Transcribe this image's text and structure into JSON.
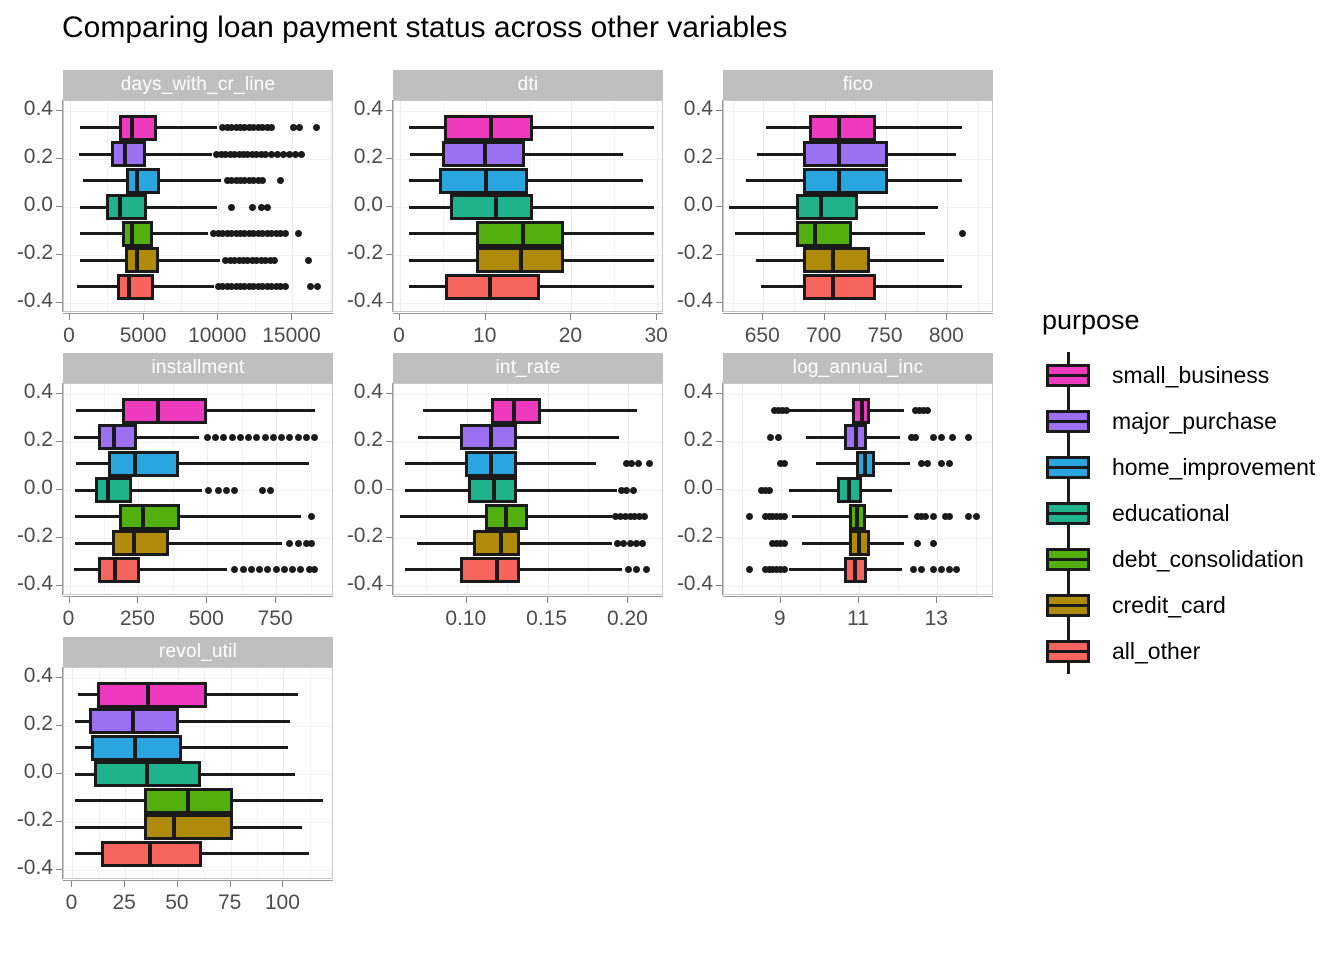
{
  "title": "Comparing loan payment status across other variables",
  "legend": {
    "title": "purpose",
    "items": [
      {
        "label": "small_business",
        "color": "#ED3ABF"
      },
      {
        "label": "major_purchase",
        "color": "#9B71F2"
      },
      {
        "label": "home_improvement",
        "color": "#2AA5E0"
      },
      {
        "label": "educational",
        "color": "#20B28A"
      },
      {
        "label": "debt_consolidation",
        "color": "#53AF0E"
      },
      {
        "label": "credit_card",
        "color": "#B08A0B"
      },
      {
        "label": "all_other",
        "color": "#F5655E"
      }
    ]
  },
  "facets": [
    {
      "name": "days_with_cr_line"
    },
    {
      "name": "dti"
    },
    {
      "name": "fico"
    },
    {
      "name": "installment"
    },
    {
      "name": "int_rate"
    },
    {
      "name": "log_annual_inc"
    },
    {
      "name": "revol_util"
    }
  ],
  "y_axis": {
    "ticks": [
      "0.4",
      "0.2",
      "0.0",
      "-0.2",
      "-0.4"
    ],
    "values": [
      0.4,
      0.2,
      0.0,
      -0.2,
      -0.4
    ],
    "limits": [
      -0.44,
      0.44
    ]
  },
  "chart_data": {
    "type": "box",
    "title": "Comparing loan payment status across other variables",
    "orientation": "horizontal",
    "legend_title": "purpose",
    "legend_position": "right",
    "grid": true,
    "ylabel": "",
    "xlabel": "",
    "y_tick_labels": [
      "0.4",
      "0.2",
      "0.0",
      "-0.2",
      "-0.4"
    ],
    "y_positions_by_group": [
      0.33,
      0.22,
      0.11,
      0.0,
      -0.11,
      -0.22,
      -0.33
    ],
    "groups": [
      "small_business",
      "major_purchase",
      "home_improvement",
      "educational",
      "debt_consolidation",
      "credit_card",
      "all_other"
    ],
    "group_colors": [
      "#ED3ABF",
      "#9B71F2",
      "#2AA5E0",
      "#20B28A",
      "#53AF0E",
      "#B08A0B",
      "#F5655E"
    ],
    "panels": [
      {
        "name": "days_with_cr_line",
        "xlim": [
          -400,
          17800
        ],
        "xticks": [
          0,
          5000,
          10000,
          15000
        ],
        "xtick_labels": [
          "0",
          "5000",
          "10000",
          "15000"
        ],
        "boxes": [
          {
            "group": "small_business",
            "lo": 680,
            "q1": 3300,
            "med": 4200,
            "q3": 5900,
            "hi": 9900,
            "outliers": [
              10300,
              10600,
              10900,
              11200,
              11500,
              11800,
              12100,
              12400,
              12700,
              13000,
              13300,
              13600,
              15100,
              15500,
              16600
            ]
          },
          {
            "group": "major_purchase",
            "lo": 600,
            "q1": 2800,
            "med": 3700,
            "q3": 5100,
            "hi": 9600,
            "outliers": [
              9900,
              10200,
              10500,
              10800,
              11100,
              11400,
              11700,
              12000,
              12300,
              12600,
              12900,
              13200,
              13600,
              14000,
              14400,
              14800,
              15200,
              15600
            ]
          },
          {
            "group": "home_improvement",
            "lo": 900,
            "q1": 3800,
            "med": 4500,
            "q3": 6100,
            "hi": 10200,
            "outliers": [
              10600,
              10900,
              11200,
              11500,
              11800,
              12100,
              12400,
              12700,
              13000,
              14200
            ]
          },
          {
            "group": "educational",
            "lo": 700,
            "q1": 2400,
            "med": 3400,
            "q3": 5200,
            "hi": 9900,
            "outliers": [
              10900,
              12300,
              12900,
              13300
            ]
          },
          {
            "group": "debt_consolidation",
            "lo": 700,
            "q1": 3500,
            "med": 4200,
            "q3": 5600,
            "hi": 9300,
            "outliers": [
              9700,
              10000,
              10300,
              10600,
              10900,
              11200,
              11500,
              11800,
              12100,
              12400,
              12700,
              13000,
              13300,
              13600,
              13900,
              14200,
              14500,
              15400
            ]
          },
          {
            "group": "credit_card",
            "lo": 700,
            "q1": 3700,
            "med": 4500,
            "q3": 6000,
            "hi": 10100,
            "outliers": [
              10500,
              10800,
              11100,
              11400,
              11700,
              12000,
              12300,
              12600,
              12900,
              13200,
              13500,
              13800,
              16100
            ]
          },
          {
            "group": "all_other",
            "lo": 500,
            "q1": 3200,
            "med": 4000,
            "q3": 5700,
            "hi": 9700,
            "outliers": [
              10000,
              10300,
              10600,
              10900,
              11200,
              11500,
              11800,
              12100,
              12400,
              12700,
              13000,
              13300,
              13600,
              13900,
              14200,
              14500,
              16200,
              16700
            ]
          }
        ]
      },
      {
        "name": "dti",
        "xlim": [
          -0.7,
          30.8
        ],
        "xticks": [
          0,
          10,
          20,
          30
        ],
        "xtick_labels": [
          "0",
          "10",
          "20",
          "30"
        ],
        "boxes": [
          {
            "group": "small_business",
            "lo": 1.1,
            "q1": 5.1,
            "med": 10.6,
            "q3": 15.5,
            "hi": 29.6,
            "outliers": []
          },
          {
            "group": "major_purchase",
            "lo": 1.2,
            "q1": 4.9,
            "med": 9.9,
            "q3": 14.6,
            "hi": 26.0,
            "outliers": []
          },
          {
            "group": "home_improvement",
            "lo": 1.0,
            "q1": 4.6,
            "med": 10.0,
            "q3": 14.9,
            "hi": 28.3,
            "outliers": []
          },
          {
            "group": "educational",
            "lo": 1.1,
            "q1": 5.8,
            "med": 11.2,
            "q3": 15.5,
            "hi": 29.6,
            "outliers": []
          },
          {
            "group": "debt_consolidation",
            "lo": 1.0,
            "q1": 8.9,
            "med": 14.3,
            "q3": 19.1,
            "hi": 29.6,
            "outliers": []
          },
          {
            "group": "credit_card",
            "lo": 1.0,
            "q1": 8.9,
            "med": 14.1,
            "q3": 19.1,
            "hi": 29.6,
            "outliers": []
          },
          {
            "group": "all_other",
            "lo": 1.0,
            "q1": 5.3,
            "med": 10.5,
            "q3": 16.3,
            "hi": 29.6,
            "outliers": []
          }
        ]
      },
      {
        "name": "fico",
        "xlim": [
          618,
          838
        ],
        "xticks": [
          650,
          700,
          750,
          800
        ],
        "xtick_labels": [
          "650",
          "700",
          "750",
          "800"
        ],
        "boxes": [
          {
            "group": "small_business",
            "lo": 652,
            "q1": 687,
            "med": 712,
            "q3": 742,
            "hi": 812,
            "outliers": []
          },
          {
            "group": "major_purchase",
            "lo": 645,
            "q1": 682,
            "med": 712,
            "q3": 752,
            "hi": 807,
            "outliers": []
          },
          {
            "group": "home_improvement",
            "lo": 636,
            "q1": 682,
            "med": 712,
            "q3": 752,
            "hi": 812,
            "outliers": []
          },
          {
            "group": "educational",
            "lo": 622,
            "q1": 677,
            "med": 697,
            "q3": 727,
            "hi": 792,
            "outliers": []
          },
          {
            "group": "debt_consolidation",
            "lo": 627,
            "q1": 677,
            "med": 692,
            "q3": 722,
            "hi": 782,
            "outliers": [
              812
            ]
          },
          {
            "group": "credit_card",
            "lo": 644,
            "q1": 682,
            "med": 707,
            "q3": 737,
            "hi": 797,
            "outliers": []
          },
          {
            "group": "all_other",
            "lo": 648,
            "q1": 682,
            "med": 707,
            "q3": 742,
            "hi": 812,
            "outliers": []
          }
        ]
      },
      {
        "name": "installment",
        "xlim": [
          -20,
          960
        ],
        "xticks": [
          0,
          250,
          500,
          750
        ],
        "xtick_labels": [
          "0",
          "250",
          "500",
          "750"
        ],
        "boxes": [
          {
            "group": "small_business",
            "lo": 22,
            "q1": 192,
            "med": 320,
            "q3": 500,
            "hi": 890,
            "outliers": []
          },
          {
            "group": "major_purchase",
            "lo": 16,
            "q1": 105,
            "med": 160,
            "q3": 244,
            "hi": 470,
            "outliers": [
              500,
              530,
              560,
              590,
              620,
              650,
              680,
              710,
              740,
              770,
              800,
              830,
              860,
              890
            ]
          },
          {
            "group": "home_improvement",
            "lo": 24,
            "q1": 140,
            "med": 236,
            "q3": 398,
            "hi": 870,
            "outliers": []
          },
          {
            "group": "educational",
            "lo": 20,
            "q1": 92,
            "med": 140,
            "q3": 228,
            "hi": 480,
            "outliers": [
              505,
              540,
              570,
              600,
              700,
              730
            ]
          },
          {
            "group": "debt_consolidation",
            "lo": 20,
            "q1": 178,
            "med": 266,
            "q3": 400,
            "hi": 840,
            "outliers": [
              880
            ]
          },
          {
            "group": "credit_card",
            "lo": 20,
            "q1": 156,
            "med": 234,
            "q3": 360,
            "hi": 770,
            "outliers": [
              800,
              830,
              860,
              880
            ]
          },
          {
            "group": "all_other",
            "lo": 18,
            "q1": 105,
            "med": 166,
            "q3": 256,
            "hi": 570,
            "outliers": [
              600,
              630,
              660,
              690,
              720,
              750,
              780,
              810,
              840,
              870,
              890
            ]
          }
        ]
      },
      {
        "name": "int_rate",
        "xlim": [
          0.055,
          0.222
        ],
        "xticks": [
          0.1,
          0.15,
          0.2
        ],
        "xtick_labels": [
          "0.10",
          "0.15",
          "0.20"
        ],
        "boxes": [
          {
            "group": "small_business",
            "lo": 0.073,
            "q1": 0.115,
            "med": 0.129,
            "q3": 0.146,
            "hi": 0.205,
            "outliers": []
          },
          {
            "group": "major_purchase",
            "lo": 0.07,
            "q1": 0.096,
            "med": 0.115,
            "q3": 0.131,
            "hi": 0.194,
            "outliers": []
          },
          {
            "group": "home_improvement",
            "lo": 0.062,
            "q1": 0.099,
            "med": 0.115,
            "q3": 0.131,
            "hi": 0.18,
            "outliers": [
              0.199,
              0.202,
              0.206,
              0.213
            ]
          },
          {
            "group": "educational",
            "lo": 0.062,
            "q1": 0.101,
            "med": 0.117,
            "q3": 0.131,
            "hi": 0.193,
            "outliers": [
              0.196,
              0.199,
              0.203
            ]
          },
          {
            "group": "debt_consolidation",
            "lo": 0.059,
            "q1": 0.111,
            "med": 0.124,
            "q3": 0.138,
            "hi": 0.19,
            "outliers": [
              0.192,
              0.195,
              0.198,
              0.201,
              0.204,
              0.207,
              0.21
            ]
          },
          {
            "group": "credit_card",
            "lo": 0.069,
            "q1": 0.104,
            "med": 0.121,
            "q3": 0.133,
            "hi": 0.19,
            "outliers": [
              0.193,
              0.197,
              0.201,
              0.205,
              0.209
            ]
          },
          {
            "group": "all_other",
            "lo": 0.062,
            "q1": 0.096,
            "med": 0.119,
            "q3": 0.133,
            "hi": 0.196,
            "outliers": [
              0.2,
              0.205,
              0.211
            ]
          }
        ]
      },
      {
        "name": "log_annual_inc",
        "xlim": [
          7.55,
          14.45
        ],
        "xticks": [
          9,
          11,
          13
        ],
        "xtick_labels": [
          "9",
          "11",
          "13"
        ],
        "boxes": [
          {
            "group": "small_business",
            "lo": 9.21,
            "q1": 10.82,
            "med": 11.08,
            "q3": 11.29,
            "hi": 12.15,
            "outliers": [
              8.85,
              8.95,
              9.05,
              9.15,
              12.45,
              12.55,
              12.65,
              12.75
            ]
          },
          {
            "group": "major_purchase",
            "lo": 9.65,
            "q1": 10.62,
            "med": 10.93,
            "q3": 11.2,
            "hi": 12.05,
            "outliers": [
              8.75,
              8.95,
              12.35,
              12.45,
              12.9,
              13.1,
              13.4,
              13.8
            ]
          },
          {
            "group": "home_improvement",
            "lo": 9.9,
            "q1": 10.92,
            "med": 11.15,
            "q3": 11.4,
            "hi": 12.3,
            "outliers": [
              9.0,
              9.1,
              12.6,
              12.75,
              13.1,
              13.3
            ]
          },
          {
            "group": "educational",
            "lo": 9.2,
            "q1": 10.45,
            "med": 10.75,
            "q3": 11.07,
            "hi": 11.85,
            "outliers": [
              8.5,
              8.6,
              8.7
            ]
          },
          {
            "group": "debt_consolidation",
            "lo": 9.3,
            "q1": 10.75,
            "med": 10.95,
            "q3": 11.18,
            "hi": 12.25,
            "outliers": [
              8.2,
              8.6,
              8.7,
              8.8,
              8.9,
              9.0,
              9.1,
              12.5,
              12.6,
              12.7,
              12.9,
              13.2,
              13.3,
              13.8,
              14.0
            ]
          },
          {
            "group": "credit_card",
            "lo": 9.55,
            "q1": 10.75,
            "med": 11.0,
            "q3": 11.28,
            "hi": 12.15,
            "outliers": [
              8.8,
              8.9,
              9.0,
              9.1,
              12.5,
              12.9
            ]
          },
          {
            "group": "all_other",
            "lo": 9.2,
            "q1": 10.62,
            "med": 10.9,
            "q3": 11.2,
            "hi": 12.1,
            "outliers": [
              8.2,
              8.6,
              8.7,
              8.8,
              8.9,
              9.0,
              9.1,
              12.4,
              12.6,
              12.9,
              13.1,
              13.3,
              13.5
            ]
          }
        ]
      },
      {
        "name": "revol_util",
        "xlim": [
          -4,
          124
        ],
        "xticks": [
          0,
          25,
          50,
          75,
          100
        ],
        "xtick_labels": [
          "0",
          "25",
          "50",
          "75",
          "100"
        ],
        "boxes": [
          {
            "group": "small_business",
            "lo": 2.5,
            "q1": 11.5,
            "med": 36.0,
            "q3": 64.0,
            "hi": 107.0,
            "outliers": []
          },
          {
            "group": "major_purchase",
            "lo": 1.0,
            "q1": 8.0,
            "med": 28.5,
            "q3": 50.5,
            "hi": 103.0,
            "outliers": []
          },
          {
            "group": "home_improvement",
            "lo": 1.0,
            "q1": 9.0,
            "med": 29.5,
            "q3": 52.0,
            "hi": 102.0,
            "outliers": []
          },
          {
            "group": "educational",
            "lo": 1.0,
            "q1": 10.0,
            "med": 35.5,
            "q3": 61.0,
            "hi": 105.5,
            "outliers": []
          },
          {
            "group": "debt_consolidation",
            "lo": 1.0,
            "q1": 34.0,
            "med": 55.0,
            "q3": 76.0,
            "hi": 119.0,
            "outliers": []
          },
          {
            "group": "credit_card",
            "lo": 1.0,
            "q1": 34.0,
            "med": 48.0,
            "q3": 76.0,
            "hi": 109.0,
            "outliers": []
          },
          {
            "group": "all_other",
            "lo": 1.0,
            "q1": 13.5,
            "med": 37.0,
            "q3": 61.5,
            "hi": 112.0,
            "outliers": []
          }
        ]
      }
    ]
  }
}
